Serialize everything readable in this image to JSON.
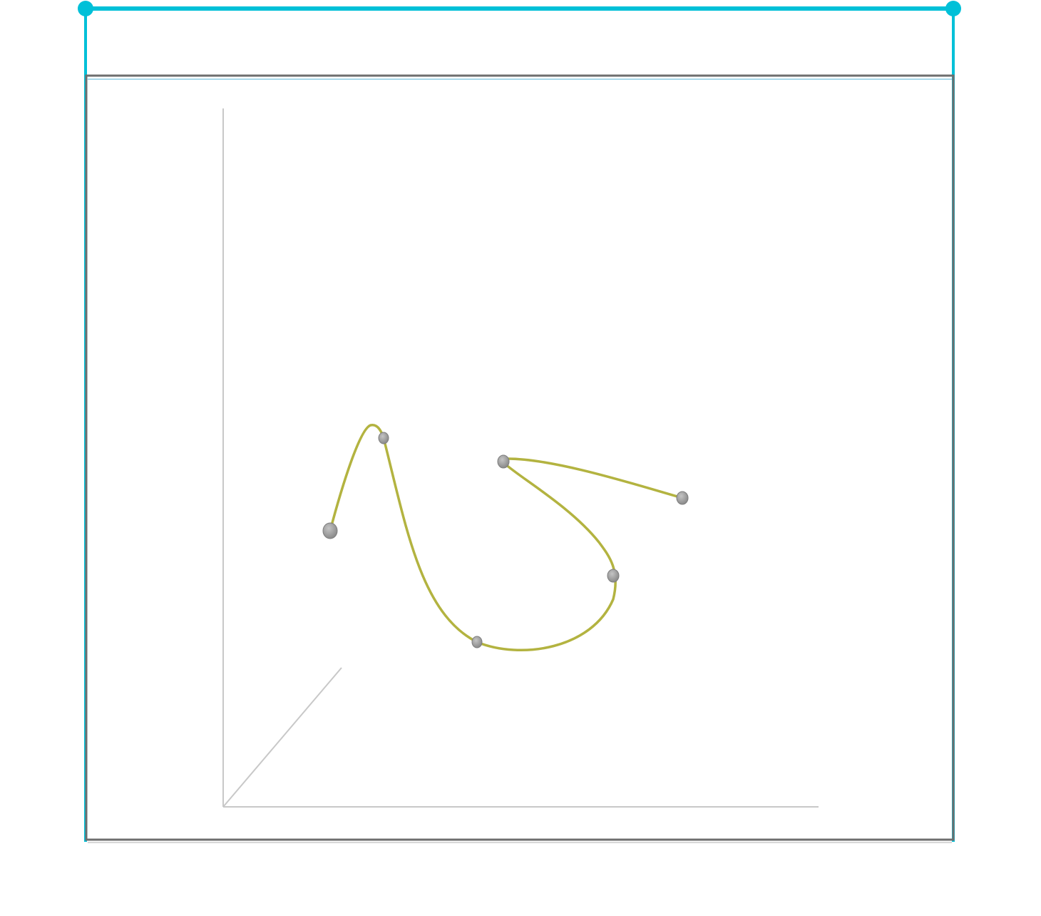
{
  "colors": {
    "accent": "#00c0d8",
    "frame": "#6e6e6e",
    "frame_inner_line": "#a9d8ea",
    "axes": "#c8c8c8",
    "curve": "#b3b340",
    "point_fill": "#9a9a9a",
    "point_stroke": "#7e7e7e",
    "background": "#ffffff"
  },
  "width_dimension": {
    "ends": [
      "handle-left",
      "handle-right"
    ]
  },
  "axes": {
    "labels": [],
    "dimensions": 3
  },
  "curve": {
    "type": "spline",
    "control_point_count": 6
  }
}
